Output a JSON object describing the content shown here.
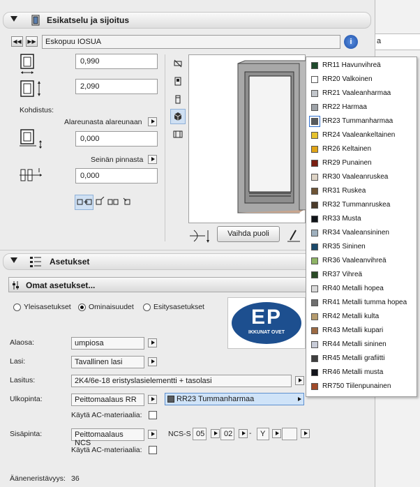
{
  "panel1": {
    "title": "Esikatselu ja sijoitus",
    "favorite_name": "Eskopuu IOSUA",
    "width_value": "0,990",
    "height_value": "2,090",
    "anchor_label": "Kohdistus:",
    "anchor_mode": "Alareunasta alareunaan",
    "sill_value": "0,000",
    "reveal_mode": "Seinän pinnasta",
    "reveal_value": "0,000",
    "flip_button": "Vaihda puoli"
  },
  "panel2": {
    "title": "Asetukset",
    "own_settings": "Omat asetukset...",
    "tabs": [
      "Yleisasetukset",
      "Ominaisuudet",
      "Esitysasetukset"
    ],
    "selected_tab": "Ominaisuudet",
    "logo": {
      "line1": "EP",
      "line2": "IKKUNAT OVET"
    },
    "rows": [
      {
        "label": "Alaosa:",
        "value": "umpiosa"
      },
      {
        "label": "Lasi:",
        "value": "Tavallinen lasi"
      },
      {
        "label": "Lasitus:",
        "value": "2K4/6e-18 eristyslasielementti + tasolasi"
      },
      {
        "label": "Ulkopinta:",
        "value": "Peittomaalaus RR",
        "color_value": "RR23 Tummanharmaa"
      },
      {
        "label": "Sisäpinta:",
        "value": "Peittomaalaus NCS"
      }
    ],
    "ac_material_label": "Käytä AC-materiaalia:",
    "ncs": {
      "prefix": "NCS-S",
      "v1": "05",
      "v2": "02",
      "dash": "-",
      "v3": "Y",
      "v4": ""
    },
    "sound_label": "Ääneneristävyys:",
    "sound_value": "36"
  },
  "right_strip_text": "a",
  "color_menu": [
    {
      "label": "RR11 Havunvihreä",
      "color": "#1f4a2c"
    },
    {
      "label": "RR20 Valkoinen",
      "color": "#ffffff"
    },
    {
      "label": "RR21 Vaaleanharmaa",
      "color": "#c2c6cb"
    },
    {
      "label": "RR22 Harmaa",
      "color": "#9ea3a8"
    },
    {
      "label": "RR23 Tummanharmaa",
      "color": "#585b5e",
      "selected": true
    },
    {
      "label": "RR24 Vaaleankeltainen",
      "color": "#e6c22e"
    },
    {
      "label": "RR26 Keltainen",
      "color": "#e0a417"
    },
    {
      "label": "RR29 Punainen",
      "color": "#7a1f12"
    },
    {
      "label": "RR30 Vaaleanruskea",
      "color": "#ddd3c5"
    },
    {
      "label": "RR31 Ruskea",
      "color": "#6e5435"
    },
    {
      "label": "RR32 Tummanruskea",
      "color": "#4a3a2a"
    },
    {
      "label": "RR33 Musta",
      "color": "#101418"
    },
    {
      "label": "RR34 Vaaleansininen",
      "color": "#9fb0be"
    },
    {
      "label": "RR35 Sininen",
      "color": "#1b4a6b"
    },
    {
      "label": "RR36 Vaaleanvihreä",
      "color": "#8fb466"
    },
    {
      "label": "RR37 Vihreä",
      "color": "#2a4a26"
    },
    {
      "label": "RR40 Metalli hopea",
      "color": "#d9d9d9"
    },
    {
      "label": "RR41 Metalli tumma hopea",
      "color": "#6f6f6f"
    },
    {
      "label": "RR42 Metalli kulta",
      "color": "#b59b6e"
    },
    {
      "label": "RR43 Metalli kupari",
      "color": "#9c6a43"
    },
    {
      "label": "RR44 Metalli sininen",
      "color": "#c8ccd8"
    },
    {
      "label": "RR45 Metalli grafiitti",
      "color": "#3f3f3f"
    },
    {
      "label": "RR46 Metalli musta",
      "color": "#12141a"
    },
    {
      "label": "RR750 Tiilenpunainen",
      "color": "#a04a2a"
    }
  ]
}
